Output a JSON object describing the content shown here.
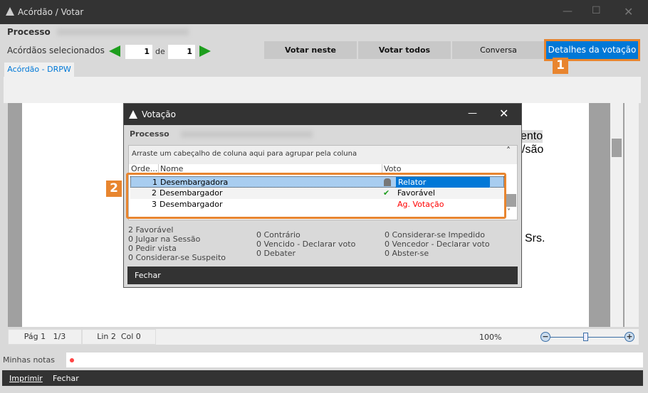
{
  "window": {
    "title": "Acórdão / Votar",
    "icon": "app-logo-icon"
  },
  "header": {
    "processo_label": "Processo",
    "selecionados_label": "Acórdãos selecionados",
    "current": "1",
    "de_label": "de",
    "total": "1"
  },
  "toolbar": {
    "buttons": [
      "Votar neste",
      "Votar todos",
      "Conversa",
      "Detalhes da votação"
    ],
    "active": "Detalhes da votação",
    "accent": "#0078d7"
  },
  "annotations": [
    "1",
    "2"
  ],
  "tab": "Acórdão - DRPW",
  "document": {
    "fragments": [
      "ento",
      "/são",
      "Srs."
    ]
  },
  "status": {
    "page": "Pág 1",
    "pages": "1/3",
    "line": "Lin 2",
    "col": "Col 0",
    "zoom": "100%",
    "zoom_level_percent": 50
  },
  "notes": {
    "label": "Minhas notas"
  },
  "bottom": {
    "print": "Imprimir",
    "close": "Fechar"
  },
  "dialog": {
    "title": "Votação",
    "processo_label": "Processo",
    "group_hint": "Arraste um cabeçalho de coluna aqui para agrupar pela coluna",
    "columns": [
      "Orde...",
      "Nome",
      "Voto"
    ],
    "rows": [
      {
        "ordem": "1",
        "nome": "Desembargadora",
        "voto": "Relator",
        "icon": "judge-icon"
      },
      {
        "ordem": "2",
        "nome": "Desembargador",
        "voto": "Favorável",
        "icon": "check-icon"
      },
      {
        "ordem": "3",
        "nome": "Desembargador",
        "voto": "Ag. Votação",
        "icon": ""
      }
    ],
    "summary": [
      [
        "2 Favorável",
        "0 Julgar na Sessão",
        "0 Pedir vista",
        "0 Considerar-se Suspeito"
      ],
      [
        "0 Contrário",
        "0 Vencido - Declarar voto",
        "0 Debater"
      ],
      [
        "0 Considerar-se Impedido",
        "0 Vencedor - Declarar voto",
        "0 Abster-se"
      ]
    ],
    "close": "Fechar"
  }
}
